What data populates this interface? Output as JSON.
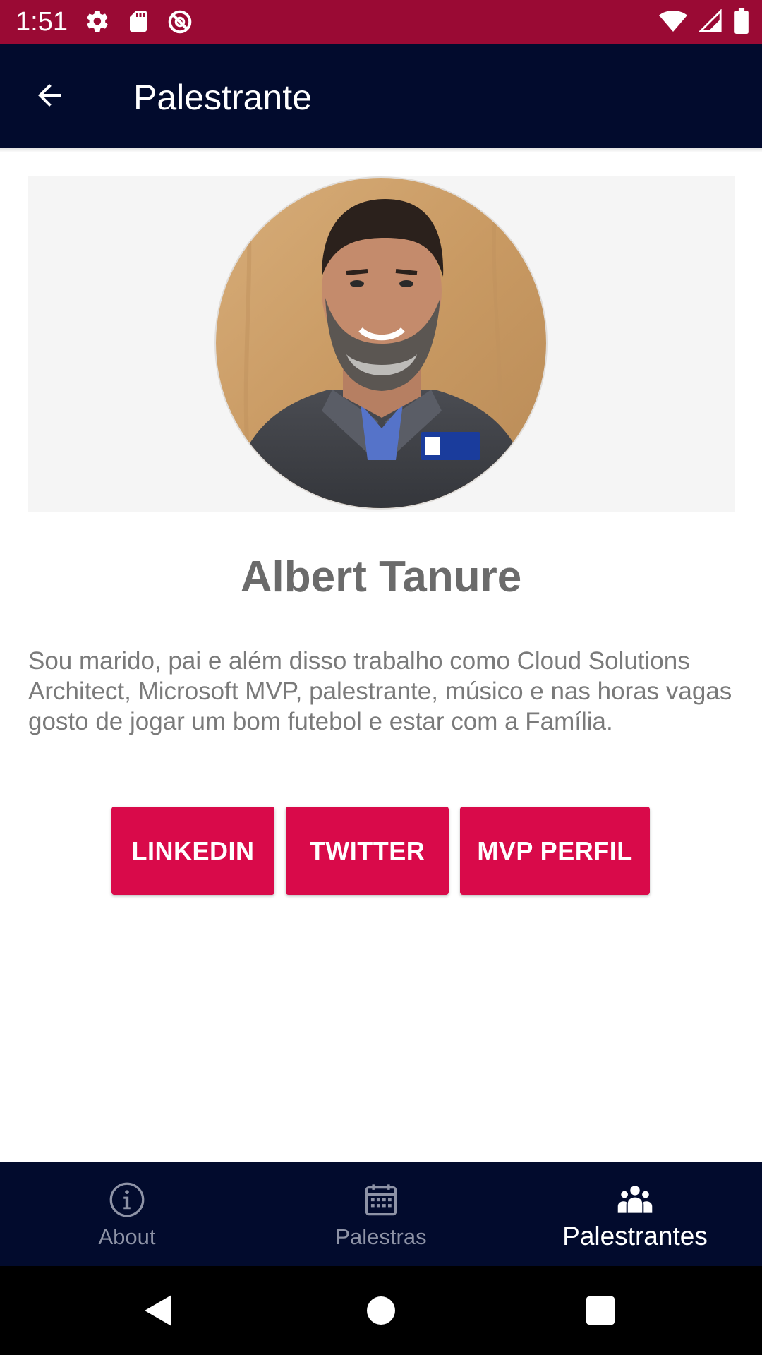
{
  "status_bar": {
    "time": "1:51",
    "icons": [
      "settings-icon",
      "sd-card-icon",
      "do-not-disturb-icon",
      "wifi-icon",
      "cellular-signal-icon",
      "battery-icon"
    ]
  },
  "app_bar": {
    "title": "Palestrante",
    "back_icon": "arrow-back-icon"
  },
  "speaker": {
    "name": "Albert Tanure",
    "bio": "Sou marido, pai e além disso trabalho como Cloud Solutions Architect, Microsoft MVP, palestrante, músico e nas horas vagas gosto de jogar um bom futebol e estar com a Família."
  },
  "buttons": {
    "linkedin": "LINKEDIN",
    "twitter": "TWITTER",
    "mvp": "MVP PERFIL"
  },
  "bottom_nav": {
    "items": [
      {
        "label": "About",
        "icon": "info-icon",
        "active": false
      },
      {
        "label": "Palestras",
        "icon": "calendar-icon",
        "active": false
      },
      {
        "label": "Palestrantes",
        "icon": "people-icon",
        "active": true
      }
    ]
  },
  "system_nav": [
    "back-triangle-icon",
    "home-circle-icon",
    "recents-square-icon"
  ],
  "colors": {
    "status_bar": "#9a0a34",
    "app_bar": "#020b2d",
    "accent_button": "#d90a4a",
    "name_text": "#6b6b6b",
    "bio_text": "#7a7a7a",
    "nav_inactive": "#8e93a6",
    "nav_active": "#ffffff"
  }
}
